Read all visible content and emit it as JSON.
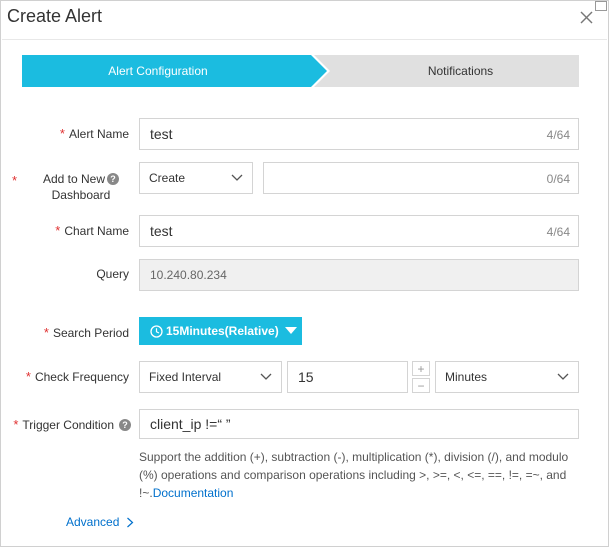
{
  "dialog": {
    "title": "Create Alert"
  },
  "steps": [
    {
      "label": "Alert Configuration",
      "active": true
    },
    {
      "label": "Notifications",
      "active": false
    }
  ],
  "form": {
    "required_marker": "*",
    "alert_name": {
      "label": "Alert Name",
      "value": "test",
      "counter": "4/64"
    },
    "dashboard": {
      "label_line1": "Add to New",
      "label_line2": "Dashboard",
      "help_icon": "?",
      "select_value": "Create",
      "input_value": "",
      "counter": "0/64"
    },
    "chart_name": {
      "label": "Chart Name",
      "value": "test",
      "counter": "4/64"
    },
    "query": {
      "label": "Query",
      "value": "10.240.80.234"
    },
    "search_period": {
      "label": "Search Period",
      "value": "15Minutes(Relative)"
    },
    "check_frequency": {
      "label": "Check Frequency",
      "type_value": "Fixed Interval",
      "number_value": "15",
      "plus": "+",
      "minus": "−",
      "unit_value": "Minutes"
    },
    "trigger_condition": {
      "label": "Trigger Condition",
      "help_icon": "?",
      "value": "client_ip !=“ ”",
      "help_text": "Support the addition (+), subtraction (-), multiplication (*), division (/), and modulo (%) operations and comparison operations including >, >=, <, <=, ==, !=, =~, and !~.",
      "doc_link": "Documentation"
    },
    "advanced": "Advanced"
  },
  "colors": {
    "accent": "#1bbce0",
    "link": "#0070cc",
    "required": "#e03030"
  }
}
